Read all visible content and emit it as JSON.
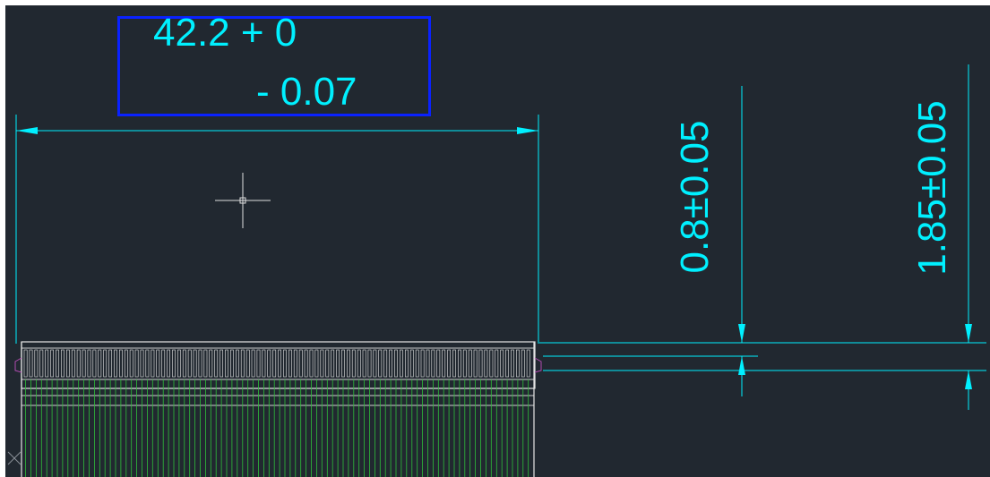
{
  "app": {
    "background_color": "#212830",
    "dimension_color": "#00f0ff",
    "highlight_box_color": "#0a22ff",
    "connector_outline_color": "#e6e6e6",
    "connector_pin_color": "#2fbf3a"
  },
  "dimensions": {
    "width_tolerance": {
      "main_value_text": "42.2 + 0",
      "lower_deviation_text": "- 0.07"
    },
    "thickness_dim": "0.8±0.05",
    "height_dim": "1.85±0.05"
  },
  "cursor": {
    "type": "crosshair-cursor"
  },
  "ucs": {
    "icon": "ucs-x-icon"
  }
}
